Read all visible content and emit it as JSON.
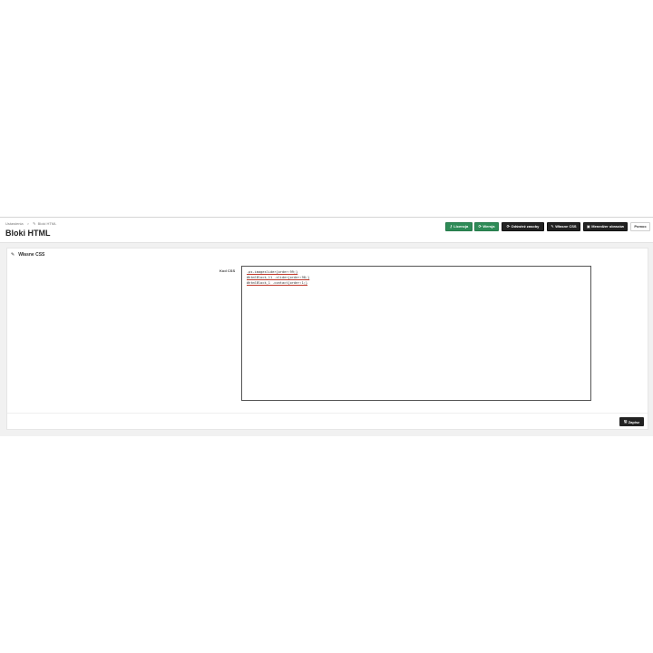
{
  "breadcrumb": {
    "items": [
      "Ustawienia",
      "Bloki HTML"
    ],
    "separator": ">",
    "icon": "edit-icon"
  },
  "page": {
    "title": "Bloki HTML"
  },
  "toolbar": {
    "buttons": [
      {
        "label": "Licencja",
        "icon": "key-icon",
        "style": "green"
      },
      {
        "label": "Wersja",
        "icon": "refresh-icon",
        "style": "green"
      },
      {
        "label": "Odśwież zasoby",
        "icon": "refresh-icon",
        "style": "dark"
      },
      {
        "label": "Własne CSS",
        "icon": "edit-icon",
        "style": "dark"
      },
      {
        "label": "Menedżer obrazów",
        "icon": "image-icon",
        "style": "dark"
      },
      {
        "label": "Pomoc",
        "icon": "",
        "style": "light"
      }
    ]
  },
  "panel": {
    "heading": "Własne CSS",
    "heading_icon": "edit-icon",
    "field_label": "Kod CSS",
    "code_lines": [
      ".ps-imageslider{order:99;}",
      "#htmlBlock_11 .slider{order:98;}",
      "#htmlBlock_1 .contact{order:1;}"
    ],
    "save_label": "Zapisz",
    "save_icon": "save-icon"
  },
  "colors": {
    "green": "#2e8b57",
    "dark": "#222222",
    "background": "#f1f1f1"
  }
}
